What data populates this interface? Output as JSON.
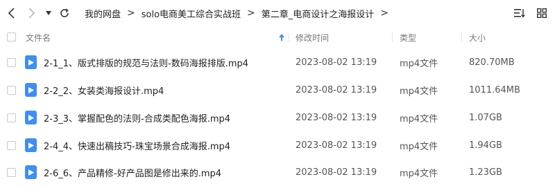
{
  "colors": {
    "accent": "#3d8ef5",
    "sort_arrow": "#3d8ef5"
  },
  "nav": {
    "breadcrumbs": [
      "我的网盘",
      "solo电商美工综合实战班",
      "第二章_电商设计之海报设计"
    ],
    "separator": ">"
  },
  "columns": {
    "name": "文件名",
    "modified": "修改时间",
    "type": "类型",
    "size": "大小"
  },
  "files": [
    {
      "name": "2-1_1、版式排版的规范与法则-数码海报排版.mp4",
      "modified": "2023-08-02 13:19",
      "type": "mp4文件",
      "size": "820.70MB",
      "icon": "video-file-icon"
    },
    {
      "name": "2-2_2、女装类海报设计.mp4",
      "modified": "2023-08-02 13:19",
      "type": "mp4文件",
      "size": "1011.64MB",
      "icon": "video-file-icon"
    },
    {
      "name": "2-3_3、掌握配色的法则-合成类配色海报.mp4",
      "modified": "2023-08-02 13:19",
      "type": "mp4文件",
      "size": "1.07GB",
      "icon": "video-file-icon"
    },
    {
      "name": "2-4_4、快速出稿技巧-珠宝场景合成海报.mp4",
      "modified": "2023-08-02 13:19",
      "type": "mp4文件",
      "size": "1.94GB",
      "icon": "video-file-icon"
    },
    {
      "name": "2-6_6、产品精修-好产品图是修出来的.mp4",
      "modified": "2023-08-02 13:19",
      "type": "mp4文件",
      "size": "1.23GB",
      "icon": "video-file-icon"
    }
  ]
}
